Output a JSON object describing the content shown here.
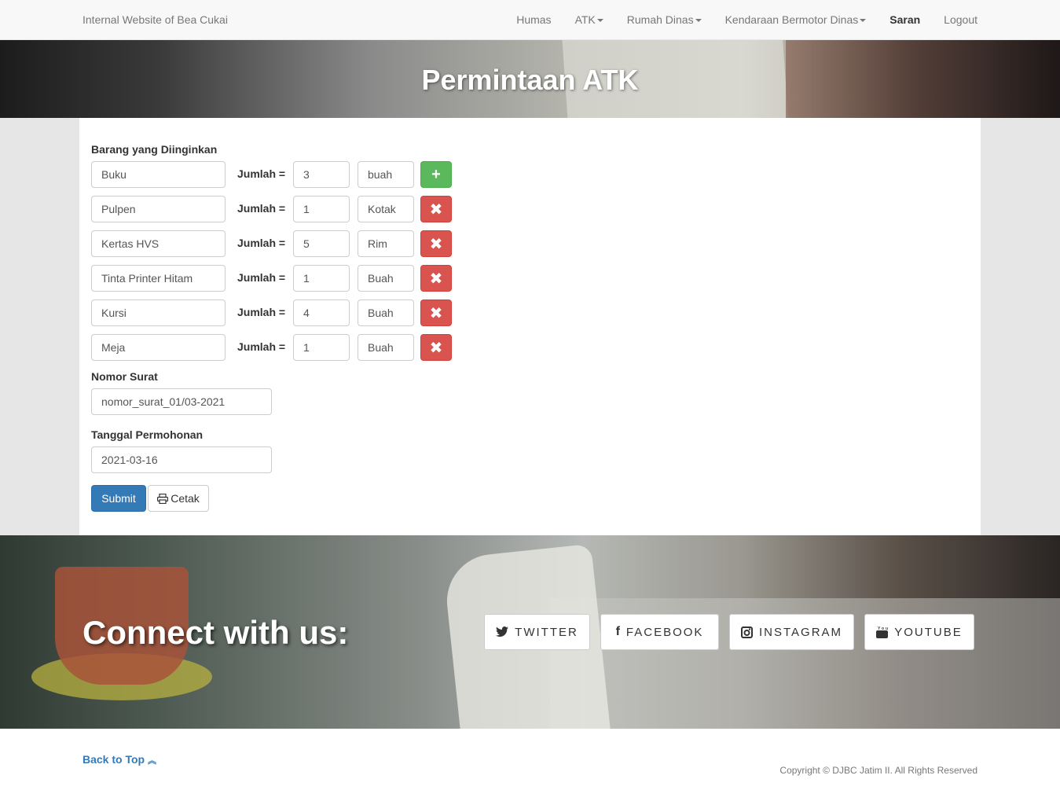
{
  "navbar": {
    "brand": "Internal Website of Bea Cukai",
    "items": [
      {
        "label": "Humas",
        "dropdown": false,
        "active": false
      },
      {
        "label": "ATK",
        "dropdown": true,
        "active": false
      },
      {
        "label": "Rumah Dinas",
        "dropdown": true,
        "active": false
      },
      {
        "label": "Kendaraan Bermotor Dinas",
        "dropdown": true,
        "active": false
      },
      {
        "label": "Saran",
        "dropdown": false,
        "active": true
      },
      {
        "label": "Logout",
        "dropdown": false,
        "active": false
      }
    ]
  },
  "header": {
    "title": "Permintaan ATK"
  },
  "form": {
    "items_label": "Barang yang Diinginkan",
    "jumlah_label": "Jumlah =",
    "rows": [
      {
        "item": "Buku",
        "qty": "3",
        "unit": "buah",
        "action": "add"
      },
      {
        "item": "Pulpen",
        "qty": "1",
        "unit": "Kotak",
        "action": "remove"
      },
      {
        "item": "Kertas HVS",
        "qty": "5",
        "unit": "Rim",
        "action": "remove"
      },
      {
        "item": "Tinta Printer Hitam",
        "qty": "1",
        "unit": "Buah",
        "action": "remove"
      },
      {
        "item": "Kursi",
        "qty": "4",
        "unit": "Buah",
        "action": "remove"
      },
      {
        "item": "Meja",
        "qty": "1",
        "unit": "Buah",
        "action": "remove"
      }
    ],
    "nomor_label": "Nomor Surat",
    "nomor_value": "nomor_surat_01/03-2021",
    "tanggal_label": "Tanggal Permohonan",
    "tanggal_value": "2021-03-16",
    "submit_label": "Submit",
    "cetak_label": "Cetak"
  },
  "connect": {
    "heading": "Connect with us:",
    "buttons": [
      {
        "label": "TWITTER",
        "icon": "twitter-icon"
      },
      {
        "label": "FACEBOOK",
        "icon": "facebook-icon"
      },
      {
        "label": "INSTAGRAM",
        "icon": "instagram-icon"
      },
      {
        "label": "YOUTUBE",
        "icon": "youtube-icon"
      }
    ]
  },
  "footer": {
    "back_to_top": "Back to Top",
    "copyright": "Copyright © DJBC Jatim II. All Rights Reserved"
  },
  "colors": {
    "primary": "#337ab7",
    "success": "#5cb85c",
    "danger": "#d9534f"
  }
}
